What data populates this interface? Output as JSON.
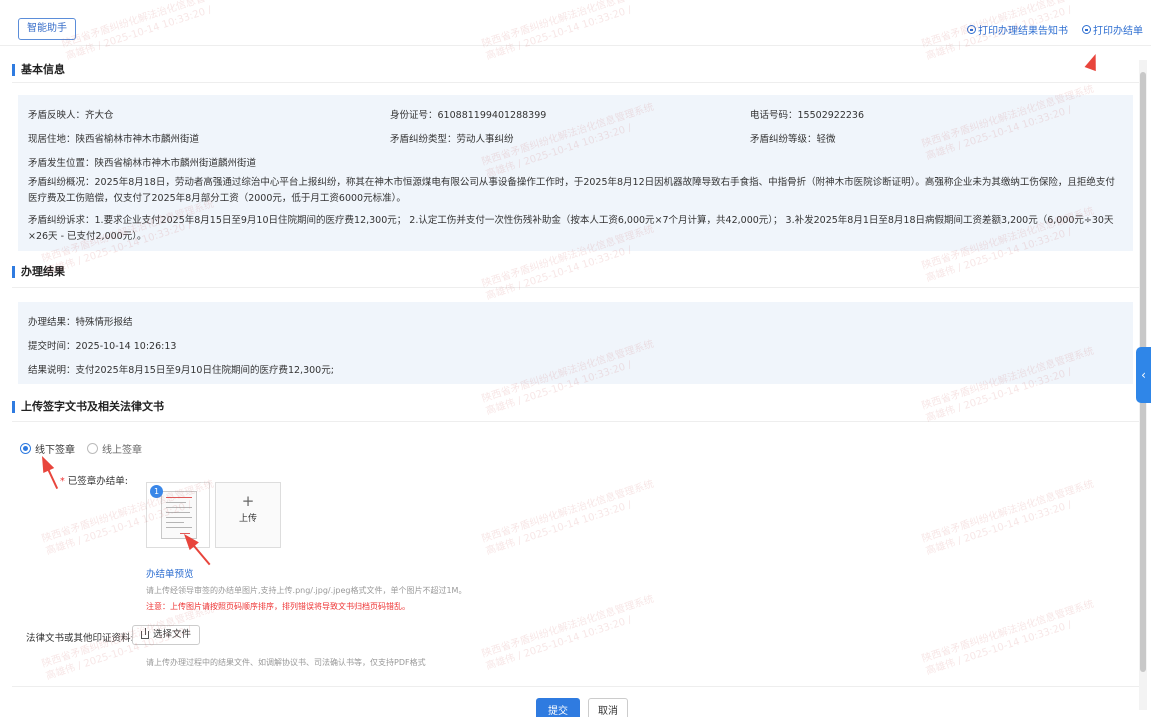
{
  "header": {
    "assistant_label": "智能助手",
    "print_notice_label": "打印办理结果告知书",
    "print_result_label": "打印办结单"
  },
  "basic_info": {
    "title": "基本信息",
    "reporter_label": "矛盾反映人：",
    "reporter": "齐大仓",
    "id_label": "身份证号：",
    "id_number": "610881199401288399",
    "phone_label": "电话号码：",
    "phone": "15502922236",
    "residence_label": "现居住地：",
    "residence": "陕西省榆林市神木市麟州街道",
    "dispute_type_label": "矛盾纠纷类型：",
    "dispute_type": "劳动人事纠纷",
    "dispute_level_label": "矛盾纠纷等级：",
    "dispute_level": "轻微",
    "location_label": "矛盾发生位置：",
    "location": "陕西省榆林市神木市麟州街道麟州街道",
    "overview_label": "矛盾纠纷概况：",
    "overview": "2025年8月18日，劳动者高强通过综治中心平台上报纠纷，称其在神木市恒源煤电有限公司从事设备操作工作时，于2025年8月12日因机器故障导致右手食指、中指骨折（附神木市医院诊断证明）。高强称企业未为其缴纳工伤保险，且拒绝支付医疗费及工伤赔偿，仅支付了2025年8月部分工资（2000元，低于月工资6000元标准）。",
    "demand_label": "矛盾纠纷诉求：",
    "demand": "1.要求企业支付2025年8月15日至9月10日住院期间的医疗费12,300元； 2.认定工伤并支付一次性伤残补助金（按本人工资6,000元×7个月计算，共42,000元）； 3.补发2025年8月1日至8月18日病假期间工资差额3,200元（6,000元÷30天×26天 - 已支付2,000元）。"
  },
  "handling": {
    "title": "办理结果",
    "result_label": "办理结果：",
    "result": "特殊情形报结",
    "submit_time_label": "提交时间：",
    "submit_time": "2025-10-14 10:26:13",
    "explain_label": "结果说明：",
    "explain": "支付2025年8月15日至9月10日住院期间的医疗费12,300元;"
  },
  "upload": {
    "title": "上传签字文书及相关法律文书",
    "offline_label": "线下签章",
    "online_label": "线上签章",
    "signed_label": "已签章办结单:",
    "badge": "1",
    "upload_plus": "+",
    "upload_label": "上传",
    "preview_label": "办结单预览",
    "hint1": "请上传经领导审签的办结单图片,支持上传.png/.jpg/.jpeg格式文件，单个图片不超过1M。",
    "hint2": "注意：上传图片请按照页码顺序排序，排列错误将导致文书归档页码错乱。",
    "legal_label": "法律文书或其他印证资料:",
    "choose_file_label": "选择文件",
    "legal_hint": "请上传办理过程中的结果文件、如调解协议书、司法确认书等，仅支持PDF格式"
  },
  "footer": {
    "submit_label": "提交",
    "cancel_label": "取消"
  },
  "side_tab_icon": "chevron-left-icon",
  "watermark": {
    "line1": "陕西省矛盾纠纷化解法治化信息管理系统",
    "line2": "高雄伟 / 2025-10-14 10:33:20 /"
  },
  "colors": {
    "accent": "#2f7be0",
    "panel_bg": "#f0f5fb",
    "arrow": "#e8453c",
    "warning": "#e33333"
  }
}
